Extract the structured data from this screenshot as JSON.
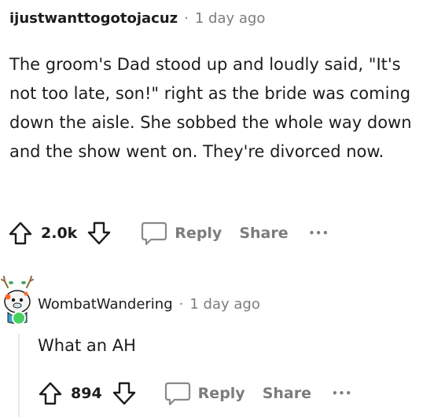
{
  "top_comment": {
    "author": "ijustwanttogotojacuz",
    "separator": "·",
    "time": "1 day ago",
    "body": "The groom's Dad stood up and loudly said, \"It's not too late, son!\" right as the bride was coming down the aisle. She sobbed the whole way down and the show went on. They're divorced now.",
    "votes": "2.0k",
    "reply_label": "Reply",
    "share_label": "Share",
    "more_label": "•••"
  },
  "reply_comment": {
    "author": "WombatWandering",
    "separator": "·",
    "time": "1 day ago",
    "body": "What an AH",
    "votes": "894",
    "reply_label": "Reply",
    "share_label": "Share",
    "more_label": "•••"
  },
  "colors": {
    "text": "#1c1c1c",
    "muted": "#7c7c7c",
    "online": "#46d160"
  }
}
